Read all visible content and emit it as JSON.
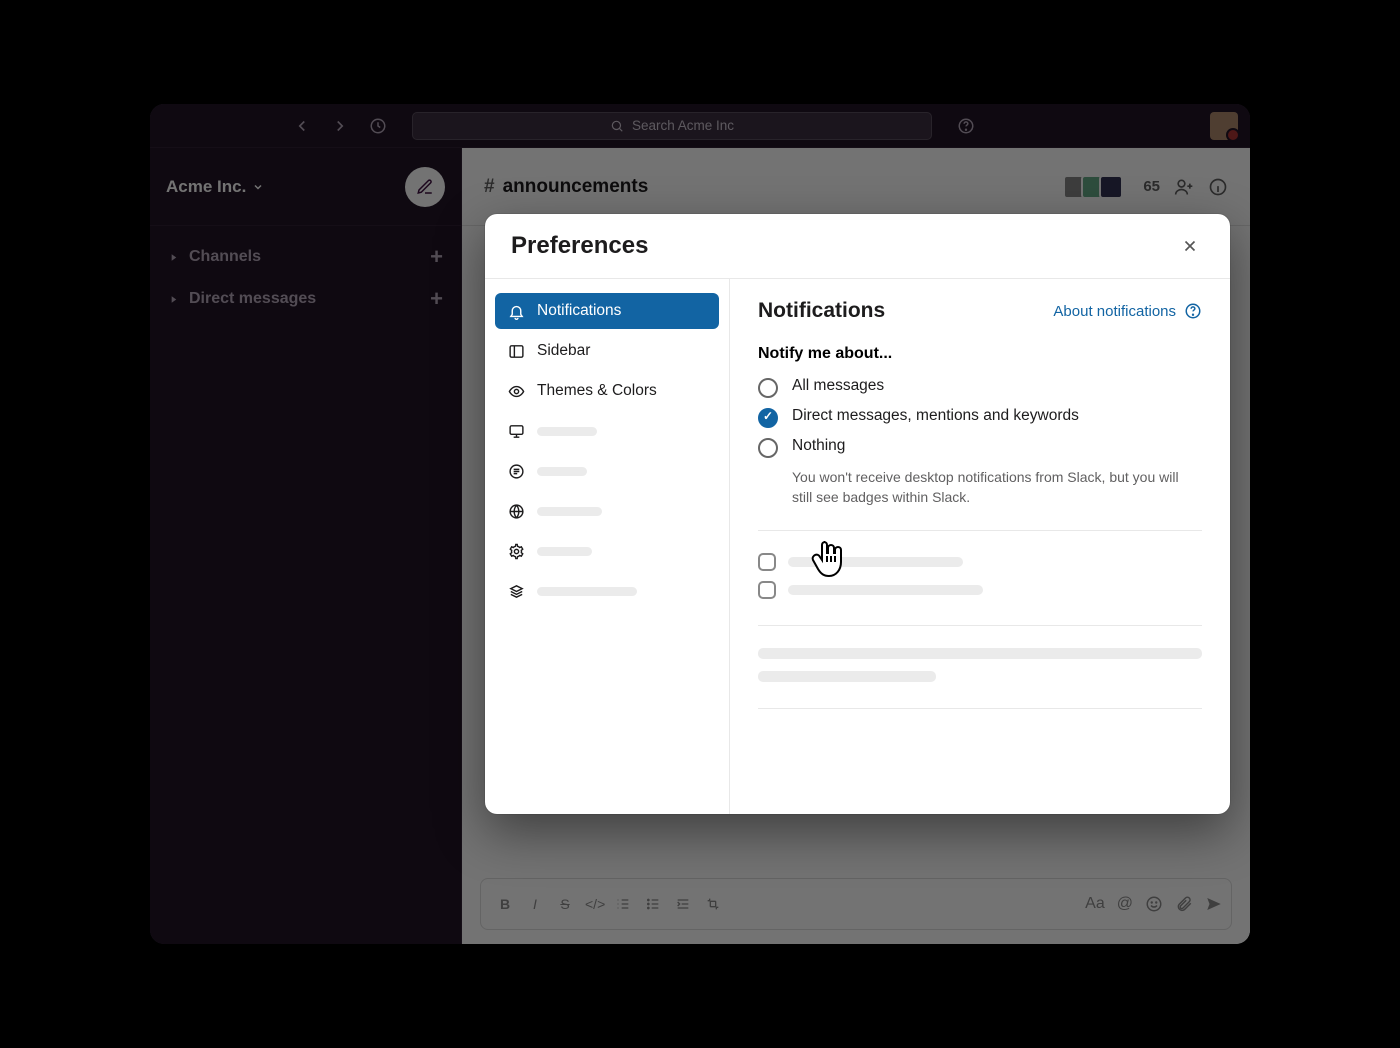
{
  "topbar": {
    "search_placeholder": "Search Acme Inc"
  },
  "workspace": {
    "name": "Acme Inc."
  },
  "sidebar": {
    "sections": {
      "channels": "Channels",
      "dms": "Direct messages"
    }
  },
  "channel": {
    "prefix": "#",
    "name": "announcements",
    "member_count": "65"
  },
  "modal": {
    "title": "Preferences",
    "nav": {
      "notifications": "Notifications",
      "sidebar": "Sidebar",
      "themes": "Themes & Colors"
    },
    "main": {
      "title": "Notifications",
      "about_link": "About notifications",
      "notify_heading": "Notify me about...",
      "options": {
        "all": "All messages",
        "dm": "Direct messages, mentions and keywords",
        "nothing": "Nothing"
      },
      "nothing_desc": "You won't receive desktop notifications from Slack, but you will still see badges within Slack."
    }
  }
}
